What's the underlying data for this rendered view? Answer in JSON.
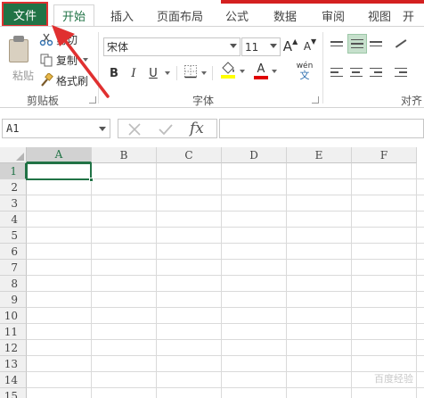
{
  "tabs": {
    "file": "文件",
    "items": [
      "开始",
      "插入",
      "页面布局",
      "公式",
      "数据",
      "审阅",
      "视图",
      "开"
    ]
  },
  "clipboard": {
    "paste": "粘贴",
    "cut": "剪切",
    "copy": "复制",
    "format_painter": "格式刷",
    "group_label": "剪贴板"
  },
  "font": {
    "font_name": "宋体",
    "font_size": "11",
    "grow": "A",
    "shrink": "A",
    "bold": "B",
    "italic": "I",
    "underline": "U",
    "font_color_letter": "A",
    "phonetic": "wén",
    "phonetic_sub": "文",
    "group_label": "字体"
  },
  "alignment": {
    "group_label": "对齐"
  },
  "formula_bar": {
    "name_box": "A1",
    "fx_label": "fx",
    "value": ""
  },
  "grid": {
    "columns": [
      "A",
      "B",
      "C",
      "D",
      "E",
      "F"
    ],
    "rows": [
      "1",
      "2",
      "3",
      "4",
      "5",
      "6",
      "7",
      "8",
      "9",
      "10",
      "11",
      "12",
      "13",
      "14",
      "15"
    ],
    "active_cell": "A1"
  },
  "colors": {
    "excel_green": "#217346",
    "annotation_red": "#e03030",
    "fill_yellow": "#ffff00",
    "font_red": "#e00000",
    "selected_align": "#c6e0cc"
  },
  "watermark": "百度经验"
}
